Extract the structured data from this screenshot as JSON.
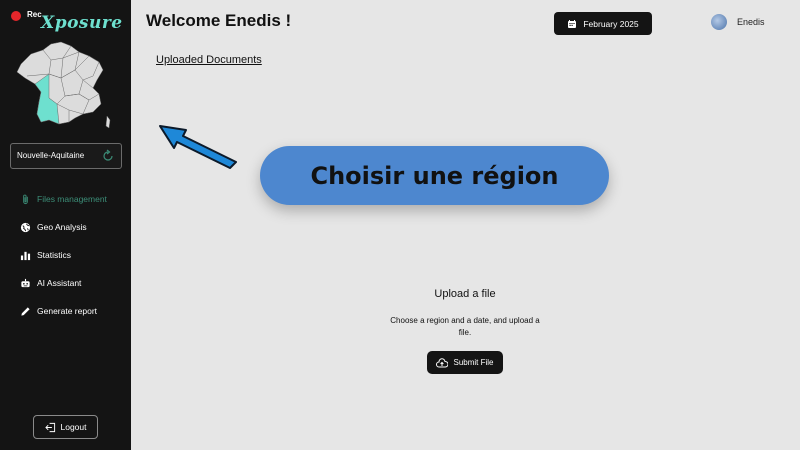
{
  "app": {
    "logo_prefix": "Rec",
    "logo_script": "Xposure",
    "accent_color": "#3c8e78"
  },
  "sidebar": {
    "region_select": {
      "value": "Nouvelle-Aquitaine",
      "icon": "refresh-icon"
    },
    "items": [
      {
        "label": "Files management",
        "icon": "paperclip-icon",
        "active": true
      },
      {
        "label": "Geo Analysis",
        "icon": "globe-icon",
        "active": false
      },
      {
        "label": "Statistics",
        "icon": "bar-chart-icon",
        "active": false
      },
      {
        "label": "AI Assistant",
        "icon": "robot-icon",
        "active": false
      },
      {
        "label": "Generate report",
        "icon": "pencil-icon",
        "active": false
      }
    ],
    "logout_label": "Logout"
  },
  "header": {
    "welcome": "Welcome Enedis !",
    "date_label": "February 2025",
    "user_name": "Enedis"
  },
  "main": {
    "uploaded_link": "Uploaded Documents",
    "banner_text": "Choisir une région",
    "banner_color": "#4d87cf",
    "upload_title": "Upload a file",
    "upload_desc": "Choose a region and a date, and upload a file.",
    "submit_label": "Submit File"
  }
}
